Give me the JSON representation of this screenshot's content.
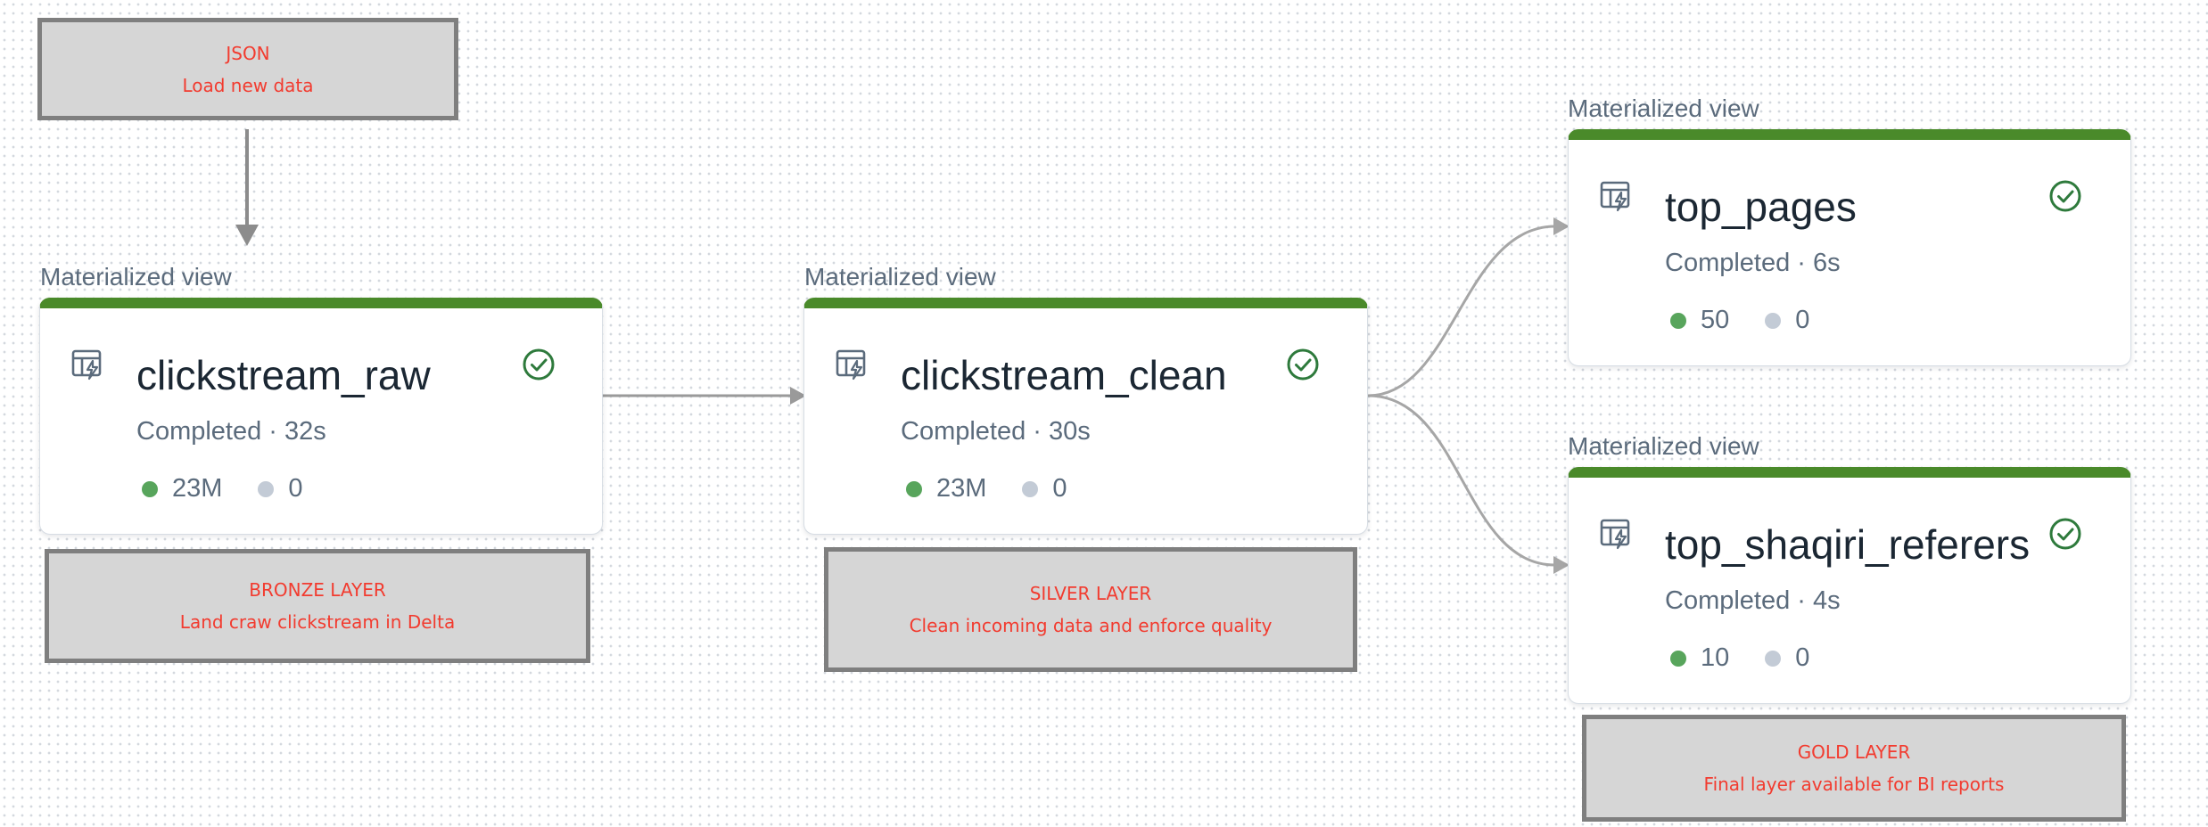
{
  "notes": {
    "json": {
      "title": "JSON",
      "subtitle": "Load new data"
    },
    "bronze": {
      "title": "BRONZE LAYER",
      "subtitle": "Land craw clickstream in Delta"
    },
    "silver": {
      "title": "SILVER LAYER",
      "subtitle": "Clean incoming data and enforce quality"
    },
    "gold": {
      "title": "GOLD LAYER",
      "subtitle": "Final layer available for BI reports"
    }
  },
  "nodes": {
    "clickstream_raw": {
      "kind": "Materialized view",
      "name": "clickstream_raw",
      "status": "Completed · 32s",
      "rows": "23M",
      "dropped": "0"
    },
    "clickstream_clean": {
      "kind": "Materialized view",
      "name": "clickstream_clean",
      "status": "Completed · 30s",
      "rows": "23M",
      "dropped": "0"
    },
    "top_pages": {
      "kind": "Materialized view",
      "name": "top_pages",
      "status": "Completed · 6s",
      "rows": "50",
      "dropped": "0"
    },
    "top_shaqiri_referers": {
      "kind": "Materialized view",
      "name": "top_shaqiri_referers",
      "status": "Completed · 4s",
      "rows": "10",
      "dropped": "0"
    }
  },
  "icons": {
    "node_type": "materialized-view-icon",
    "status": "check-circle-icon",
    "metric_ok": "green-dot",
    "metric_dropped": "grey-dot"
  },
  "colors": {
    "card_top_bar": "#4a8a2a",
    "success": "#2e7a3c",
    "note_text": "#f23b2f",
    "note_fill": "#d6d6d6",
    "note_border": "#7f7f7f",
    "edge": "#9a9a9a"
  }
}
